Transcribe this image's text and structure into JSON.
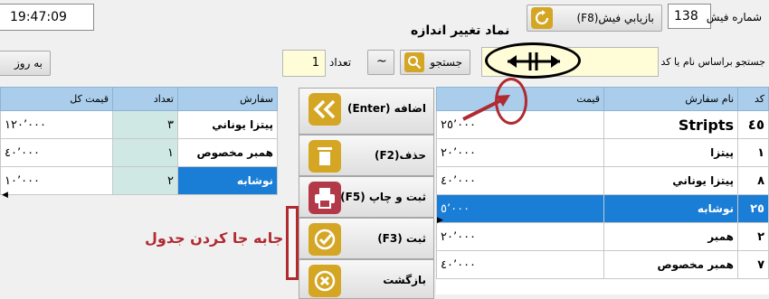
{
  "header": {
    "clock": "19:47:09",
    "invoice_label": "شماره فيش",
    "invoice_value": "138",
    "recover_button": "بازيابي فيش(F8)",
    "title": "نماد تغيير اندازه"
  },
  "search": {
    "label": "جستجو براساس نام يا كد",
    "button": "جستجو",
    "tilde": "~",
    "qty_label": "تعداد",
    "qty_value": "1",
    "update_button": "به روز"
  },
  "order_table": {
    "headers": [
      "سفارش",
      "تعداد",
      "قيمت كل"
    ],
    "rows": [
      {
        "name": "پيتزا يوناني",
        "qty": "٣",
        "total": "١٢٠٬٠٠٠"
      },
      {
        "name": "همبر مخصوص",
        "qty": "١",
        "total": "٤٠٬٠٠٠"
      },
      {
        "name": "نوشابه",
        "qty": "٢",
        "total": "١٠٬٠٠٠"
      }
    ]
  },
  "menu_table": {
    "headers": [
      "كد",
      "نام سفارش",
      "قيمت"
    ],
    "rows": [
      {
        "code": "٤٥",
        "name": "Stripts",
        "price": "٢٥٬٠٠٠"
      },
      {
        "code": "١",
        "name": "پيتزا",
        "price": "٢٠٬٠٠٠"
      },
      {
        "code": "٨",
        "name": "پيتزا يوناني",
        "price": "٤٠٬٠٠٠"
      },
      {
        "code": "٢٥",
        "name": "نوشابه",
        "price": "٥٬٠٠٠"
      },
      {
        "code": "٢",
        "name": "همبر",
        "price": "٢٠٬٠٠٠"
      },
      {
        "code": "٧",
        "name": "همبر مخصوص",
        "price": "٤٠٬٠٠٠"
      }
    ]
  },
  "actions": {
    "add": "اضافه (Enter)",
    "delete": "حذف(F2)",
    "save_print": "ثبت و چاپ (F5)",
    "save": "ثبت (F3)",
    "back": "بازگشت"
  },
  "annotation": {
    "move_table": "جابه جا كردن جدول"
  },
  "colors": {
    "accent_gold": "#d4a624",
    "accent_red": "#b23a48",
    "selection_blue": "#1a7dd6",
    "header_blue": "#a9cdea",
    "annotation_red": "#b02a30"
  }
}
